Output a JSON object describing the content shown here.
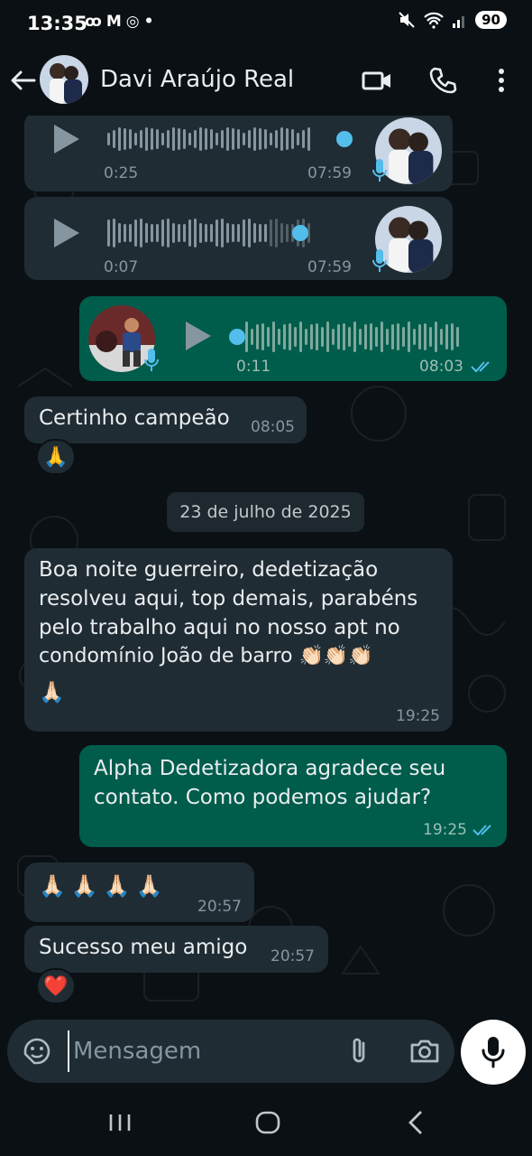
{
  "status": {
    "time": "13:35",
    "left_icons": [
      "voicemail-icon",
      "gmail-icon",
      "chrome-icon",
      "dot-icon"
    ],
    "right_icons": [
      "mute-icon",
      "wifi-icon",
      "signal-icon"
    ],
    "battery": "90"
  },
  "header": {
    "contact_name": "Davi Araújo Real",
    "icons": [
      "back-arrow-icon",
      "video-call-icon",
      "voice-call-icon",
      "more-options-icon"
    ]
  },
  "messages": [
    {
      "type": "audio",
      "direction": "incoming",
      "position": "0:25",
      "duration": "07:59",
      "progress": 1.0
    },
    {
      "type": "audio",
      "direction": "incoming",
      "position": "0:07",
      "duration": "07:59",
      "progress": 0.8
    },
    {
      "type": "audio",
      "direction": "outgoing",
      "position": "0:11",
      "duration": "08:03",
      "progress": 0.0,
      "status": "read"
    },
    {
      "type": "text",
      "direction": "incoming",
      "text": "Certinho campeão",
      "time": "08:05",
      "reaction": "🙏"
    },
    {
      "type": "date",
      "text": "23 de julho de 2025"
    },
    {
      "type": "text",
      "direction": "incoming",
      "lines": [
        "Boa noite guerreiro, dedetização",
        "resolveu aqui, top demais, parabéns",
        "pelo trabalho aqui no nosso apt no",
        "condomínio João de barro 👏🏻👏🏻👏🏻",
        "🙏🏻"
      ],
      "time": "19:25"
    },
    {
      "type": "text",
      "direction": "outgoing",
      "lines": [
        "Alpha Dedetizadora agradece seu",
        "contato. Como podemos ajudar?"
      ],
      "time": "19:25",
      "status": "read"
    },
    {
      "type": "text",
      "direction": "incoming",
      "text": "🙏🏻🙏🏻🙏🏻🙏🏻",
      "time": "20:57"
    },
    {
      "type": "text",
      "direction": "incoming",
      "text": "Sucesso meu amigo",
      "time": "20:57",
      "reaction": "❤️"
    }
  ],
  "composer": {
    "placeholder": "Mensagem",
    "icons": [
      "sticker-icon",
      "attach-icon",
      "camera-icon",
      "mic-icon"
    ]
  },
  "nav": {
    "icons": [
      "recent-apps-icon",
      "home-icon",
      "back-icon"
    ]
  },
  "colors": {
    "background": "#0b1014",
    "incoming_bubble": "#202c33",
    "outgoing_bubble": "#005c4b",
    "read_ticks": "#53bdeb",
    "secondary_text": "#8696a0"
  }
}
